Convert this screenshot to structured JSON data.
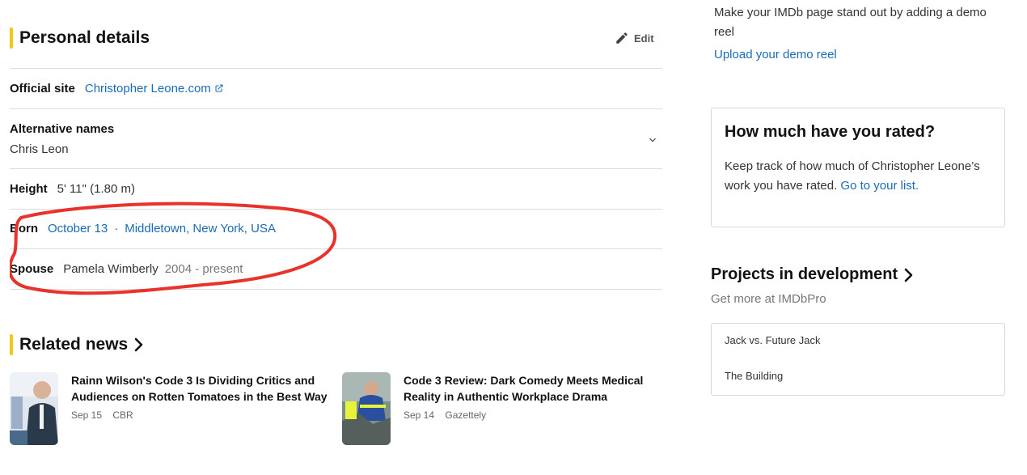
{
  "personal_details": {
    "title": "Personal details",
    "edit_label": "Edit",
    "official_site": {
      "label": "Official site",
      "link": "Christopher Leone.com"
    },
    "alternative_names": {
      "label": "Alternative names",
      "value": "Chris Leon"
    },
    "height": {
      "label": "Height",
      "value": "5' 11\" (1.80 m)"
    },
    "born": {
      "label": "Born",
      "date": "October 13",
      "separator": "·",
      "place": "Middletown, New York, USA"
    },
    "spouse": {
      "label": "Spouse",
      "name": "Pamela Wimberly",
      "years": "2004 - present"
    }
  },
  "related_news": {
    "title": "Related news",
    "items": [
      {
        "title": "Rainn Wilson's Code 3 Is Dividing Critics and Audiences on Rotten Tomatoes in the Best Way",
        "date": "Sep 15",
        "source": "CBR"
      },
      {
        "title": "Code 3 Review: Dark Comedy Meets Medical Reality in Authentic Workplace Drama",
        "date": "Sep 14",
        "source": "Gazettely"
      }
    ]
  },
  "demo_reel": {
    "text": "Make your IMDb page stand out by adding a demo reel",
    "link": "Upload your demo reel"
  },
  "rated": {
    "title": "How much have you rated?",
    "text": "Keep track of how much of Christopher Leone’s work you have rated.",
    "link": "Go to your list."
  },
  "projects": {
    "title": "Projects in development",
    "subtitle": "Get more at IMDbPro",
    "items": [
      "Jack vs. Future Jack",
      "The Building"
    ]
  },
  "colors": {
    "accent": "#f5c518",
    "link": "#1a6bb5",
    "annotation": "#e8322b"
  },
  "icons": [
    "pencil-icon",
    "external-link-icon",
    "chevron-down-icon",
    "chevron-right-icon"
  ]
}
